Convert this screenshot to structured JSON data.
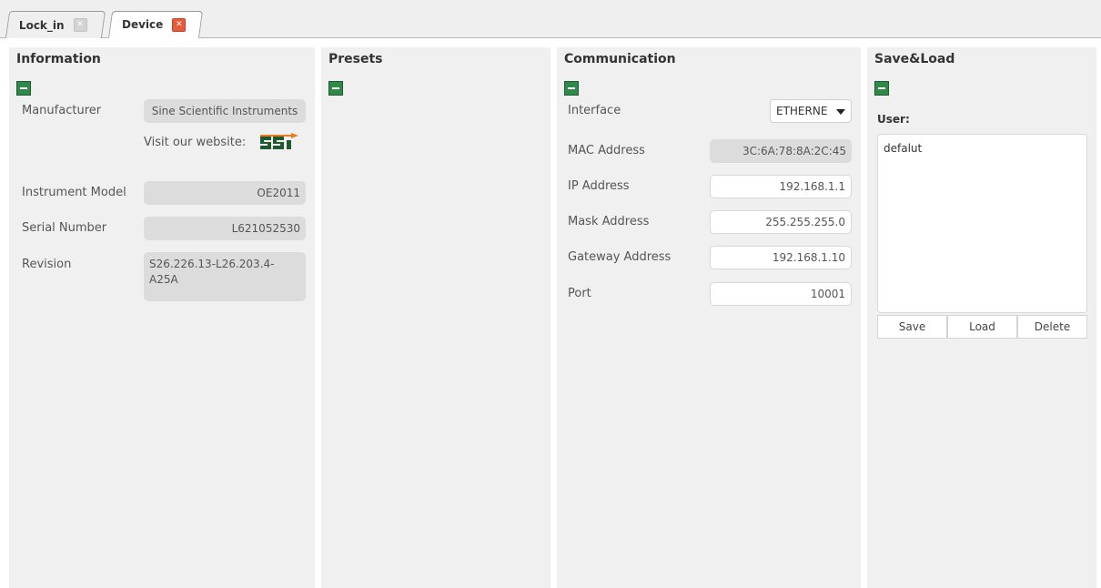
{
  "tabs": [
    {
      "label": "Lock_in",
      "close": "✕",
      "active": false
    },
    {
      "label": "Device",
      "close": "✕",
      "active": true
    }
  ],
  "information": {
    "title": "Information",
    "manufacturer_label": "Manufacturer",
    "manufacturer_value": "Sine Scientific Instruments",
    "website_label": "Visit our website:",
    "logo_icon": "ssi-logo",
    "model_label": "Instrument Model",
    "model_value": "OE2011",
    "serial_label": "Serial Number",
    "serial_value": "L621052530",
    "revision_label": "Revision",
    "revision_value": "S26.226.13-L26.203.4-A25A"
  },
  "presets": {
    "title": "Presets"
  },
  "communication": {
    "title": "Communication",
    "interface_label": "Interface",
    "interface_value": "ETHERNE",
    "mac_label": "MAC Address",
    "mac_value": "3C:6A:78:8A:2C:45",
    "ip_label": "IP Address",
    "ip_value": "192.168.1.1",
    "mask_label": "Mask Address",
    "mask_value": "255.255.255.0",
    "gateway_label": "Gateway Address",
    "gateway_value": "192.168.1.10",
    "port_label": "Port",
    "port_value": "10001"
  },
  "saveload": {
    "title": "Save&Load",
    "user_label": "User:",
    "users": [
      "defalut"
    ],
    "save_label": "Save",
    "load_label": "Load",
    "delete_label": "Delete"
  },
  "colors": {
    "collapse_button": "#2f8a4a",
    "active_close": "#e65a3b",
    "panel_bg": "#f0f0f0",
    "logo_dark": "#1f5a2e",
    "logo_accent": "#e8791d"
  }
}
